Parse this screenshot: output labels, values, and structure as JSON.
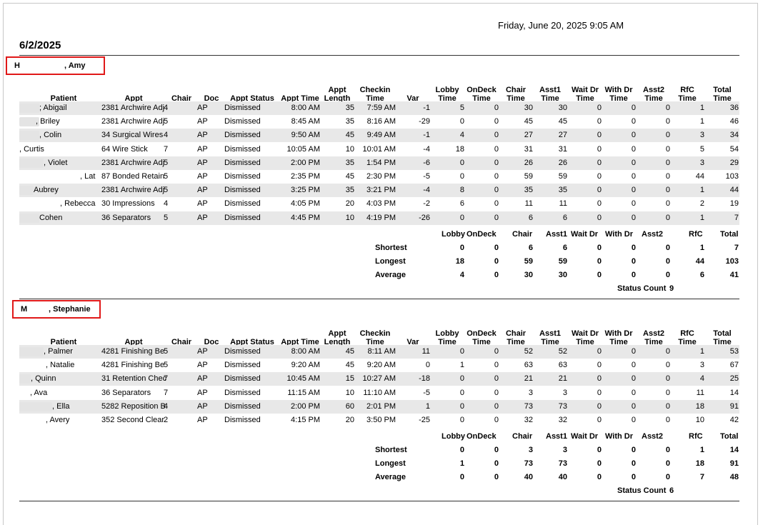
{
  "printed_timestamp": "Friday, June 20, 2025 9:05 AM",
  "report_date": "6/2/2025",
  "columns": [
    "Patient",
    "Appt",
    "Chair",
    "Doc",
    "Appt Status",
    "Appt Time",
    "Appt Length",
    "Checkin Time",
    "Var",
    "Lobby Time",
    "OnDeck Time",
    "Chair Time",
    "Asst1 Time",
    "Wait Dr Time",
    "With Dr Time",
    "Asst2 Time",
    "RfC Time",
    "Total Time"
  ],
  "summary_labels": {
    "headers": [
      "Lobby",
      "OnDeck",
      "Chair",
      "Asst1",
      "Wait Dr",
      "With Dr",
      "Asst2",
      "RfC",
      "Total"
    ],
    "rows": [
      "Shortest",
      "Longest",
      "Average"
    ],
    "status_count": "Status Count"
  },
  "groups": [
    {
      "provider_initial": "H",
      "provider_name": ", Amy",
      "rows": [
        [
          "; Abigail",
          "2381 Archwire Adj",
          "4",
          "AP",
          "Dismissed",
          "8:00 AM",
          "35",
          "7:59 AM",
          "-1",
          "5",
          "0",
          "30",
          "30",
          "0",
          "0",
          "0",
          "1",
          "36"
        ],
        [
          ", Briley",
          "2381 Archwire Adj",
          "5",
          "AP",
          "Dismissed",
          "8:45 AM",
          "35",
          "8:16 AM",
          "-29",
          "0",
          "0",
          "45",
          "45",
          "0",
          "0",
          "0",
          "1",
          "46"
        ],
        [
          ", Colin",
          "34 Surgical Wires",
          "4",
          "AP",
          "Dismissed",
          "9:50 AM",
          "45",
          "9:49 AM",
          "-1",
          "4",
          "0",
          "27",
          "27",
          "0",
          "0",
          "0",
          "3",
          "34"
        ],
        [
          ", Curtis",
          "64 Wire Stick",
          "7",
          "AP",
          "Dismissed",
          "10:05 AM",
          "10",
          "10:01 AM",
          "-4",
          "18",
          "0",
          "31",
          "31",
          "0",
          "0",
          "0",
          "5",
          "54"
        ],
        [
          ", Violet",
          "2381 Archwire Adj",
          "5",
          "AP",
          "Dismissed",
          "2:00 PM",
          "35",
          "1:54 PM",
          "-6",
          "0",
          "0",
          "26",
          "26",
          "0",
          "0",
          "0",
          "3",
          "29"
        ],
        [
          ", Lat",
          "87 Bonded Retain",
          "5",
          "AP",
          "Dismissed",
          "2:35 PM",
          "45",
          "2:30 PM",
          "-5",
          "0",
          "0",
          "59",
          "59",
          "0",
          "0",
          "0",
          "44",
          "103"
        ],
        [
          "Aubrey",
          "2381 Archwire Adj",
          "5",
          "AP",
          "Dismissed",
          "3:25 PM",
          "35",
          "3:21 PM",
          "-4",
          "8",
          "0",
          "35",
          "35",
          "0",
          "0",
          "0",
          "1",
          "44"
        ],
        [
          ", Rebecca",
          "30 Impressions",
          "4",
          "AP",
          "Dismissed",
          "4:05 PM",
          "20",
          "4:03 PM",
          "-2",
          "6",
          "0",
          "11",
          "11",
          "0",
          "0",
          "0",
          "2",
          "19"
        ],
        [
          "Cohen",
          "36 Separators",
          "5",
          "AP",
          "Dismissed",
          "4:45 PM",
          "10",
          "4:19 PM",
          "-26",
          "0",
          "0",
          "6",
          "6",
          "0",
          "0",
          "0",
          "1",
          "7"
        ]
      ],
      "summary": {
        "Shortest": [
          "0",
          "0",
          "6",
          "6",
          "0",
          "0",
          "0",
          "1",
          "7"
        ],
        "Longest": [
          "18",
          "0",
          "59",
          "59",
          "0",
          "0",
          "0",
          "44",
          "103"
        ],
        "Average": [
          "4",
          "0",
          "30",
          "30",
          "0",
          "0",
          "0",
          "6",
          "41"
        ]
      },
      "status_count": "9"
    },
    {
      "provider_initial": "M",
      "provider_name": ", Stephanie",
      "rows": [
        [
          ", Palmer",
          "4281 Finishing Be",
          "5",
          "AP",
          "Dismissed",
          "8:00 AM",
          "45",
          "8:11 AM",
          "11",
          "0",
          "0",
          "52",
          "52",
          "0",
          "0",
          "0",
          "1",
          "53"
        ],
        [
          ", Natalie",
          "4281 Finishing Be",
          "5",
          "AP",
          "Dismissed",
          "9:20 AM",
          "45",
          "9:20 AM",
          "0",
          "1",
          "0",
          "63",
          "63",
          "0",
          "0",
          "0",
          "3",
          "67"
        ],
        [
          ", Quinn",
          "31 Retention Chec",
          "7",
          "AP",
          "Dismissed",
          "10:45 AM",
          "15",
          "10:27 AM",
          "-18",
          "0",
          "0",
          "21",
          "21",
          "0",
          "0",
          "0",
          "4",
          "25"
        ],
        [
          ", Ava",
          "36 Separators",
          "7",
          "AP",
          "Dismissed",
          "11:15 AM",
          "10",
          "11:10 AM",
          "-5",
          "0",
          "0",
          "3",
          "3",
          "0",
          "0",
          "0",
          "11",
          "14"
        ],
        [
          ", Ella",
          "5282 Reposition B",
          "4",
          "AP",
          "Dismissed",
          "2:00 PM",
          "60",
          "2:01 PM",
          "1",
          "0",
          "0",
          "73",
          "73",
          "0",
          "0",
          "0",
          "18",
          "91"
        ],
        [
          ", Avery",
          "352 Second Clear",
          "2",
          "AP",
          "Dismissed",
          "4:15 PM",
          "20",
          "3:50 PM",
          "-25",
          "0",
          "0",
          "32",
          "32",
          "0",
          "0",
          "0",
          "10",
          "42"
        ]
      ],
      "summary": {
        "Shortest": [
          "0",
          "0",
          "3",
          "3",
          "0",
          "0",
          "0",
          "1",
          "14"
        ],
        "Longest": [
          "1",
          "0",
          "73",
          "73",
          "0",
          "0",
          "0",
          "18",
          "91"
        ],
        "Average": [
          "0",
          "0",
          "40",
          "40",
          "0",
          "0",
          "0",
          "7",
          "48"
        ]
      },
      "status_count": "6"
    }
  ]
}
